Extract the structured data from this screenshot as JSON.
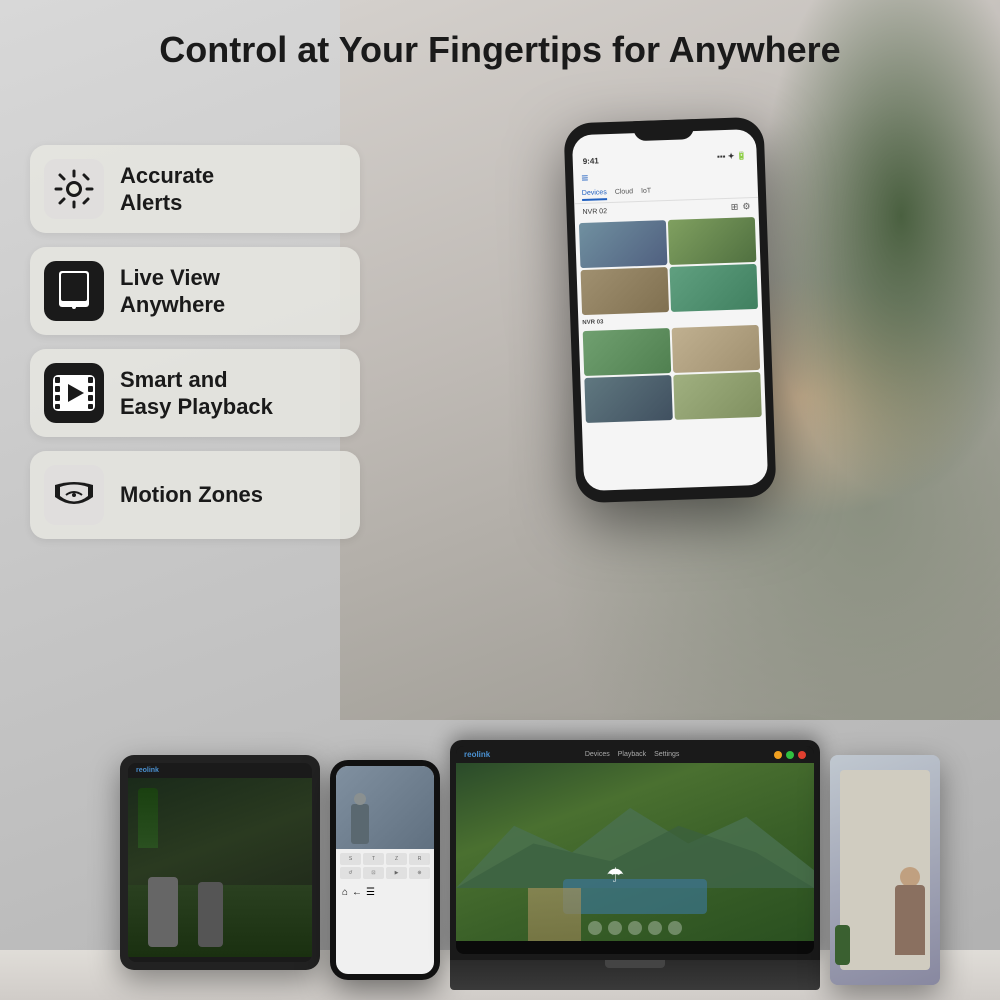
{
  "page": {
    "title": "Control at Your Fingertips for Anywhere",
    "background_color": "#d8d5d0"
  },
  "features": [
    {
      "id": "accurate-alerts",
      "label": "Accurate\nAlerts",
      "icon": "alert-icon",
      "icon_unicode": "🚨"
    },
    {
      "id": "live-view-anywhere",
      "label": "Live View\nAnywhere",
      "icon": "tablet-icon",
      "icon_unicode": "📱"
    },
    {
      "id": "smart-playback",
      "label": "Smart and\nEasy Playback",
      "icon": "play-icon",
      "icon_unicode": "▶"
    },
    {
      "id": "motion-zones",
      "label": "Motion Zones",
      "icon": "motion-icon",
      "icon_unicode": "◉"
    }
  ],
  "phone": {
    "status_time": "9:41",
    "tabs": [
      "Devices",
      "Cloud",
      "IoT"
    ],
    "nvr_labels": [
      "NVR 02",
      "NVR 03"
    ]
  },
  "devices": {
    "laptop_brand": "reolink",
    "tablet_brand": "reolink"
  }
}
